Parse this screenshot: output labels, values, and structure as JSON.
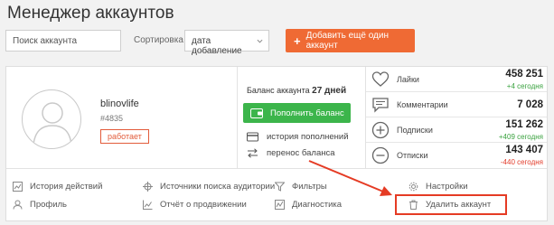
{
  "header": {
    "title": "Менеджер аккаунтов"
  },
  "toolbar": {
    "search_placeholder": "Поиск аккаунта",
    "sort_label": "Сортировка",
    "sort_value": "дата добавление",
    "add_label": "Добавить ещё один аккаунт",
    "add_color": "#ef6a34"
  },
  "account": {
    "username": "blinovlife",
    "id": "#4835",
    "status": "работает",
    "balance_label": "Баланс аккаунта",
    "balance_value": "27 дней",
    "topup_label": "Пополнить баланс",
    "history_label": "история пополнений",
    "transfer_label": "перенос баланса"
  },
  "stats": [
    {
      "icon": "heart-icon",
      "label": "Лайки",
      "value": "458 251",
      "delta": "+4 сегодня",
      "delta_type": "pos"
    },
    {
      "icon": "comment-icon",
      "label": "Комментарии",
      "value": "7 028",
      "delta": "",
      "delta_type": ""
    },
    {
      "icon": "user-plus-icon",
      "label": "Подписки",
      "value": "151 262",
      "delta": "+409 сегодня",
      "delta_type": "pos"
    },
    {
      "icon": "user-minus-icon",
      "label": "Отписки",
      "value": "143 407",
      "delta": "-440 сегодня",
      "delta_type": "neg"
    }
  ],
  "menu": {
    "history": "История действий",
    "profile": "Профиль",
    "sources": "Источники поиска аудитории",
    "promo_report": "Отчёт о продвижении",
    "filters": "Фильтры",
    "diagnostics": "Диагностика",
    "settings": "Настройки",
    "delete": "Удалить аккаунт"
  }
}
